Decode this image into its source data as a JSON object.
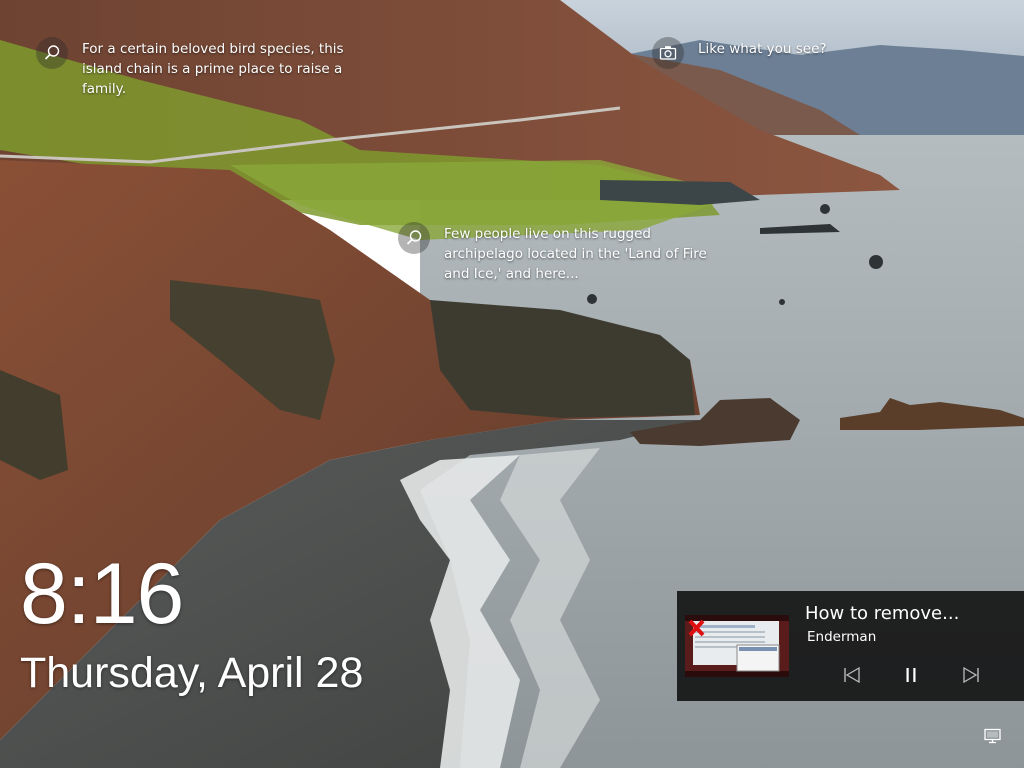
{
  "spotlight": {
    "tips": [
      {
        "icon": "search-icon",
        "text": "For a certain beloved bird species, this island chain is a prime place to raise a family."
      },
      {
        "icon": "camera-icon",
        "text": "Like what you see?"
      },
      {
        "icon": "search-icon",
        "text": "Few people live on this rugged archipelago located in the 'Land of Fire and Ice,' and here..."
      }
    ]
  },
  "clock": {
    "time": "8:16",
    "date": "Thursday, April 28"
  },
  "media": {
    "title": "How to remove...",
    "artist": "Enderman",
    "thumbnail": "video-thumbnail",
    "controls": [
      {
        "icon": "previous-track-icon"
      },
      {
        "icon": "pause-icon"
      },
      {
        "icon": "next-track-icon"
      }
    ]
  },
  "status": {
    "icon": "network-icon"
  },
  "colors": {
    "panel": "#121212",
    "sky": "#9aa8b4",
    "sea": "#a9b0b2",
    "hillside": "#7a4a34",
    "grass": "#7f9a2e"
  }
}
